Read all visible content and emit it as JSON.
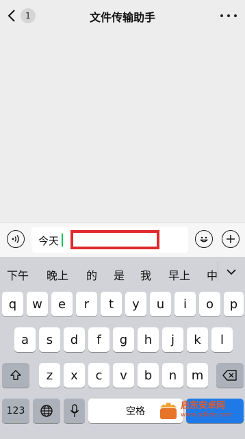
{
  "header": {
    "back_badge": "1",
    "title": "文件传输助手"
  },
  "input": {
    "value": "今天"
  },
  "candidates": [
    "下午",
    "晚上",
    "的",
    "是",
    "我",
    "早上",
    "中"
  ],
  "keyboard": {
    "row1": [
      "q",
      "w",
      "e",
      "r",
      "t",
      "y",
      "u",
      "i",
      "o",
      "p"
    ],
    "row2": [
      "a",
      "s",
      "d",
      "f",
      "g",
      "h",
      "j",
      "k",
      "l"
    ],
    "row3": [
      "z",
      "x",
      "c",
      "v",
      "b",
      "n",
      "m"
    ],
    "numbers_label": "123",
    "space_label": "空格"
  },
  "watermark": {
    "name": "启东安卓网",
    "url": "www.qdltdq.com"
  },
  "colors": {
    "highlight_border": "#e0292c",
    "caret": "#07c160",
    "keyboard_bg": "#d1d3d9"
  }
}
